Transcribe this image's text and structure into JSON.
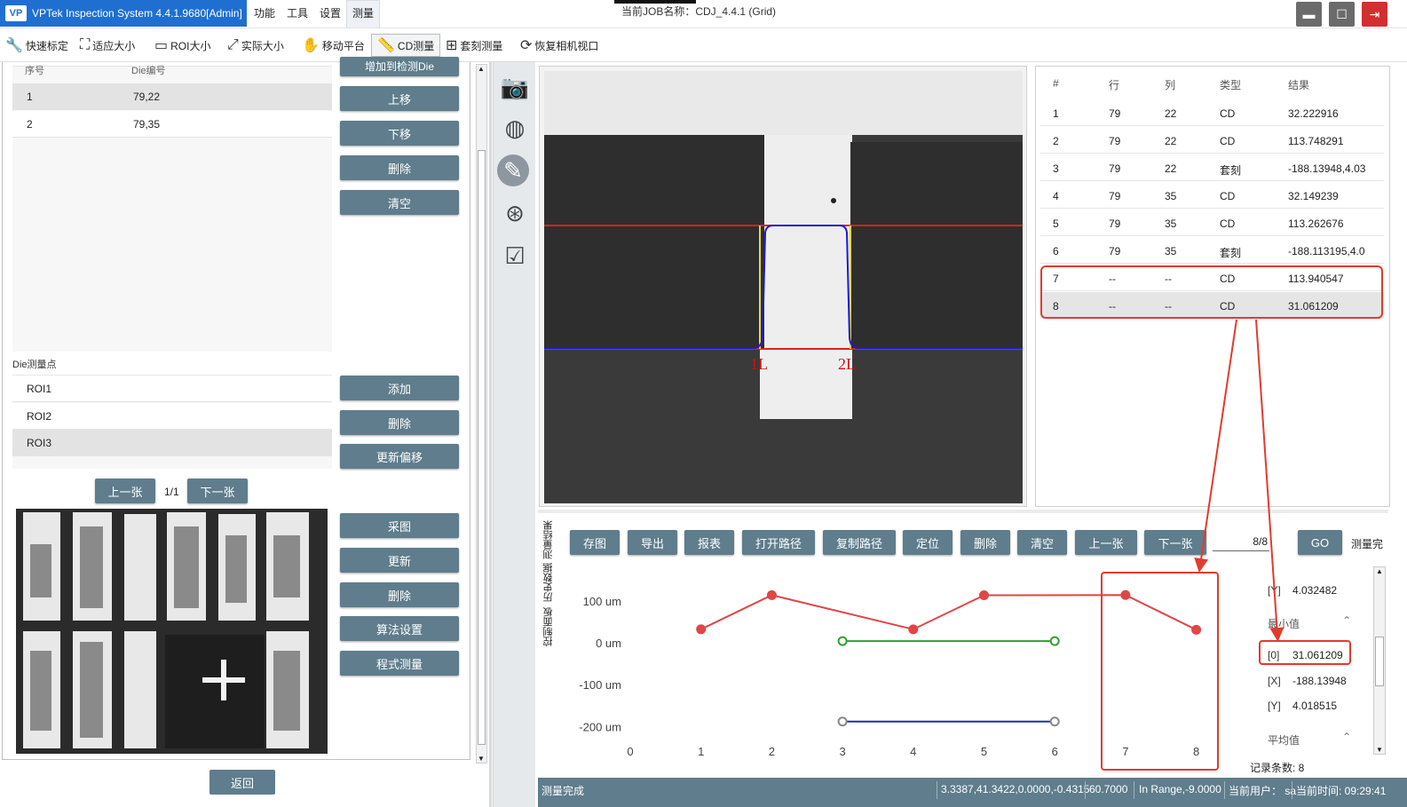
{
  "app": {
    "title": "VPTek Inspection System 4.4.1.9680[Admin]",
    "logo": "VP",
    "job_name": "当前JOB名称：CDJ_4.4.1 (Grid)"
  },
  "menu": [
    "功能",
    "工具",
    "设置",
    "测量"
  ],
  "toolbar": [
    "快速标定",
    "适应大小",
    "ROI大小",
    "实际大小",
    "移动平台",
    "CD测量",
    "套刻测量",
    "恢复相机视口"
  ],
  "die_list": {
    "headers": [
      "序号",
      "Die编号"
    ],
    "rows": [
      [
        "1",
        "79,22"
      ],
      [
        "2",
        "79,35"
      ]
    ],
    "buttons": [
      "增加到检测Die",
      "上移",
      "下移",
      "删除",
      "清空"
    ]
  },
  "measure_points": {
    "label": "Die测量点",
    "rows": [
      "ROI1",
      "ROI2",
      "ROI3"
    ],
    "buttons": [
      "添加",
      "删除",
      "更新偏移"
    ]
  },
  "pager": {
    "prev": "上一张",
    "page": "1/1",
    "next": "下一张"
  },
  "thumbnail_buttons": [
    "采图",
    "更新",
    "删除",
    "算法设置",
    "程式测量"
  ],
  "back_label": "返回",
  "image_labels": [
    "1L",
    "2L"
  ],
  "results": {
    "headers": [
      "#",
      "行",
      "列",
      "类型",
      "结果"
    ],
    "rows": [
      [
        "1",
        "79",
        "22",
        "CD",
        "32.222916"
      ],
      [
        "2",
        "79",
        "22",
        "CD",
        "113.748291"
      ],
      [
        "3",
        "79",
        "22",
        "套刻",
        "-188.13948,4.03"
      ],
      [
        "4",
        "79",
        "35",
        "CD",
        "32.149239"
      ],
      [
        "5",
        "79",
        "35",
        "CD",
        "113.262676"
      ],
      [
        "6",
        "79",
        "35",
        "套刻",
        "-188.113195,4.0"
      ],
      [
        "7",
        "--",
        "--",
        "CD",
        "113.940547"
      ],
      [
        "8",
        "--",
        "--",
        "CD",
        "31.061209"
      ]
    ]
  },
  "bottom_tabs": [
    "测量结果",
    "历史数据",
    "控制面板"
  ],
  "bottom_buttons": [
    "存图",
    "导出",
    "报表",
    "打开路径",
    "复制路径",
    "定位",
    "删除",
    "清空",
    "上一张",
    "下一张"
  ],
  "page_counter": "8/8",
  "go_label": "GO",
  "measure_status": "测量完",
  "chart_data": {
    "type": "line",
    "x_ticks": [
      "0",
      "1",
      "2",
      "3",
      "4",
      "5",
      "6",
      "7",
      "8"
    ],
    "y_ticks": [
      "100 um",
      "0 um",
      "-100 um",
      "-200 um"
    ],
    "ylim": [
      -200,
      100
    ],
    "series": [
      {
        "color": "#e04646",
        "x": [
          1,
          2,
          4,
          5,
          7,
          8
        ],
        "y": [
          32.2,
          113.7,
          32.1,
          113.3,
          113.9,
          31.1
        ]
      },
      {
        "color": "#2ea02e",
        "x": [
          3,
          6
        ],
        "y": [
          4.0,
          4.0
        ]
      },
      {
        "color": "#1f2fb0",
        "x": [
          3,
          6
        ],
        "y": [
          -188.1,
          -188.1
        ]
      }
    ]
  },
  "stats": {
    "top_y": {
      "k": "[Y]",
      "v": "4.032482"
    },
    "min_label": "最小值",
    "min": [
      {
        "k": "[0]",
        "v": "31.061209"
      },
      {
        "k": "[X]",
        "v": "-188.13948"
      },
      {
        "k": "[Y]",
        "v": "4.018515"
      }
    ],
    "avg_label": "平均值",
    "record_count": "记录条数: 8"
  },
  "statusbar": {
    "left": "测量完成",
    "coords": "3.3387,41.3422,0.0000,-0.4315",
    "value": "60.7000",
    "range": "In Range,-9.0000",
    "user": "当前用户：  sa",
    "time": "当前时间:  09:29:41"
  }
}
